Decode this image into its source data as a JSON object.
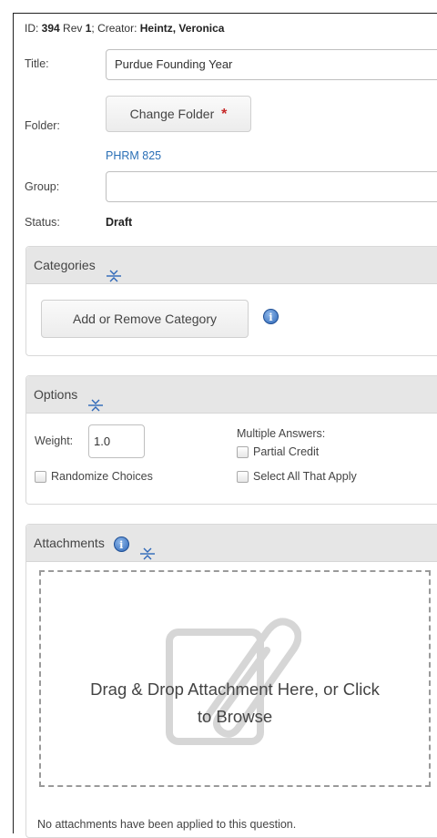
{
  "meta": {
    "id_prefix": "ID: ",
    "id_value": "394",
    "rev_prefix": " Rev ",
    "rev_value": "1",
    "creator_prefix": "; Creator: ",
    "creator_value": "Heintz, Veronica"
  },
  "fields": {
    "title_label": "Title:",
    "title_value": "Purdue Founding Year",
    "folder_label": "Folder:",
    "change_folder_label": "Change Folder",
    "required_mark": "*",
    "folder_link": "PHRM 825",
    "group_label": "Group:",
    "group_value": "",
    "status_label": "Status:",
    "status_value": "Draft"
  },
  "categories": {
    "title": "Categories",
    "add_remove_label": "Add or Remove Category",
    "info_glyph": "i"
  },
  "options": {
    "title": "Options",
    "weight_label": "Weight:",
    "weight_value": "1.0",
    "randomize_label": "Randomize Choices",
    "multiple_answers_label": "Multiple Answers:",
    "partial_credit_label": "Partial Credit",
    "select_all_label": "Select All That Apply"
  },
  "attachments": {
    "title": "Attachments",
    "info_glyph": "i",
    "drop_line1": "Drag & Drop Attachment Here, or Click",
    "drop_line2": "to Browse",
    "empty_text": "No attachments have been applied to this question."
  },
  "colors": {
    "link": "#2a6fb6",
    "required": "#c62828",
    "panel_header": "#e6e6e6",
    "info": "#2d67b8"
  },
  "icons": {
    "collapse": "collapse-vertical-icon",
    "info": "info-icon",
    "attachment": "paperclip-document-icon"
  }
}
